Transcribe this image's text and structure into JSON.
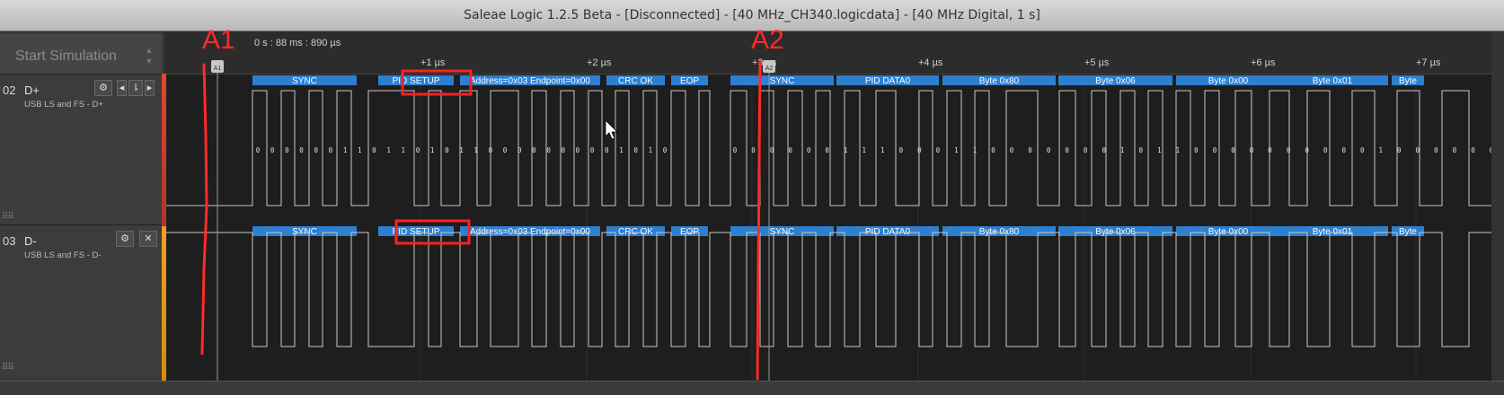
{
  "window": {
    "title": "Saleae Logic 1.2.5 Beta - [Disconnected] - [40 MHz_CH340.logicdata] - [40 MHz Digital, 1 s]"
  },
  "toolbar": {
    "start_simulation_label": "Start Simulation"
  },
  "timeline": {
    "readout": "0 s : 88 ms : 890 µs",
    "ticks": [
      "+1 µs",
      "+2 µs",
      "+3 µs",
      "+4 µs",
      "+5 µs",
      "+6 µs",
      "+7 µs"
    ]
  },
  "channels": [
    {
      "number": "02",
      "name": "D+",
      "analyzer": "USB LS and FS - D+",
      "color": "#e0452b"
    },
    {
      "number": "03",
      "name": "D-",
      "analyzer": "USB LS and FS - D-",
      "color": "#f0a020"
    }
  ],
  "packets": [
    "SYNC",
    "PID SETUP",
    "Address=0x03 Endpoint=0x00",
    "CRC OK",
    "EOP",
    "SYNC",
    "PID DATA0",
    "Byte 0x80",
    "Byte 0x06",
    "Byte 0x00",
    "Byte 0x01",
    "Byte"
  ],
  "bits_packet1": [
    "0",
    "0",
    "0",
    "0",
    "0",
    "0",
    "1",
    "1",
    "0",
    "1",
    "1",
    "0",
    "1",
    "0",
    "1",
    "1",
    "0",
    "0",
    "0",
    "0",
    "0",
    "0",
    "0",
    "0",
    "0",
    "1",
    "0",
    "1",
    "0"
  ],
  "bits_packet2": [
    "0",
    "0",
    "0",
    "0",
    "0",
    "0",
    "1",
    "1",
    "1",
    "0",
    "0",
    "0",
    "1",
    "1",
    "0",
    "0",
    "0",
    "0",
    "0",
    "0",
    "0",
    "1",
    "0",
    "1",
    "1",
    "0",
    "0",
    "0",
    "0",
    "0",
    "0",
    "0",
    "0",
    "0",
    "0",
    "1",
    "0",
    "0",
    "0",
    "0",
    "0",
    "0"
  ],
  "timing_markers": [
    "A1",
    "A2"
  ],
  "annotations": [
    "A1",
    "A2"
  ],
  "colors": {
    "packet_bar": "#2d7fd0",
    "highlight_box": "#ff2020",
    "annotation": "#ff2a2a",
    "waveform": "#c8c8c8"
  }
}
